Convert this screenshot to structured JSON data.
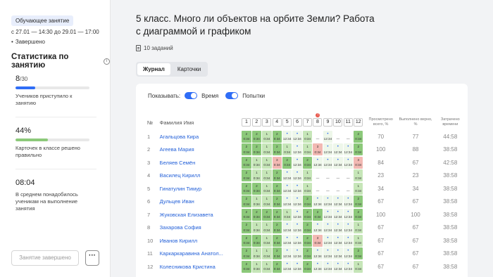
{
  "sidebar": {
    "badge": "Обучающее занятие",
    "dates": "с 27.01 — 14:30   до 29.01 — 17:00",
    "status": "Завершено",
    "stats_title": "Статистика по занятию",
    "stats": [
      {
        "value": "8",
        "suffix": "/30",
        "caption": "Учеников приступило к занятию",
        "progress": 0.27,
        "color": "#2f6df6"
      },
      {
        "value": "44%",
        "suffix": "",
        "caption": "Карточек в классе решено правильно",
        "progress": 0.44,
        "color": "#8cc97a"
      },
      {
        "value": "08:04",
        "suffix": "",
        "caption": "В среднем понадобилось ученикам на выполнение занятия"
      }
    ],
    "finish_button": "Занятие завершено",
    "more_button": "···"
  },
  "main": {
    "title": "5 класс. Много ли объектов  на орбите Земли? Работа с диаграммой и графиком",
    "tasks_count": "10 заданий",
    "tabs": [
      {
        "label": "Журнал",
        "active": true
      },
      {
        "label": "Карточки",
        "active": false
      }
    ],
    "show_label": "Показывать:",
    "toggle_time": "Время",
    "toggle_attempts": "Попытки",
    "headers": {
      "num": "№",
      "name": "Фамилия Имя",
      "viewed": "Просмотрено всего, %",
      "correct": "Выполнено верно, %",
      "spent": "Затрачено времени"
    },
    "task_numbers": [
      "1",
      "2",
      "3",
      "4",
      "5",
      "6",
      "7",
      "8",
      "9",
      "10",
      "11",
      "12"
    ],
    "rows": [
      {
        "n": "1",
        "name": "Агальцова Кира",
        "viewed": "70",
        "correct": "77",
        "time": "44:58",
        "cells": [
          "g2",
          "g2",
          "g1",
          "g2",
          "w0",
          "w0",
          "g1",
          "e0",
          "w0",
          "e0",
          "e0",
          "g2"
        ]
      },
      {
        "n": "2",
        "name": "Агеева Мария",
        "viewed": "100",
        "correct": "88",
        "time": "38:58",
        "cells": [
          "g2",
          "g2",
          "g1",
          "g2",
          "g1",
          "w0",
          "g1",
          "r0",
          "w0",
          "w0",
          "w0",
          "g2"
        ]
      },
      {
        "n": "3",
        "name": "Беляев Семён",
        "viewed": "84",
        "correct": "67",
        "time": "42:58",
        "cells": [
          "g2",
          "g1",
          "g1",
          "r0",
          "g2",
          "w0",
          "g2",
          "w0",
          "w0",
          "w0",
          "w0",
          "r0"
        ]
      },
      {
        "n": "4",
        "name": "Василец Кирилл",
        "viewed": "23",
        "correct": "23",
        "time": "38:58",
        "cells": [
          "g2",
          "g1",
          "g1",
          "g2",
          "w0",
          "w0",
          "g1",
          "e0",
          "e0",
          "e0",
          "e0",
          "g1"
        ]
      },
      {
        "n": "5",
        "name": "Гинатулин Тимур",
        "viewed": "34",
        "correct": "34",
        "time": "38:58",
        "cells": [
          "g2",
          "g2",
          "g1",
          "g2",
          "w0",
          "w0",
          "g1",
          "e0",
          "e0",
          "e0",
          "e0",
          "g1"
        ]
      },
      {
        "n": "6",
        "name": "Дульцев Иван",
        "viewed": "67",
        "correct": "67",
        "time": "38:58",
        "cells": [
          "g2",
          "g1",
          "g1",
          "g2",
          "w0",
          "w0",
          "g2",
          "w0",
          "w0",
          "w0",
          "w0",
          "g2"
        ]
      },
      {
        "n": "7",
        "name": "Жуковская Елизавета",
        "viewed": "100",
        "correct": "100",
        "time": "38:58",
        "cells": [
          "g2",
          "g2",
          "g2",
          "g2",
          "g1",
          "w0",
          "g2",
          "g2",
          "w0",
          "w0",
          "w0",
          "g2"
        ]
      },
      {
        "n": "8",
        "name": "Захарова София",
        "viewed": "67",
        "correct": "67",
        "time": "38:58",
        "cells": [
          "g2",
          "g1",
          "g1",
          "g2",
          "w0",
          "w0",
          "g2",
          "w0",
          "w0",
          "w0",
          "w0",
          "g1"
        ]
      },
      {
        "n": "10",
        "name": "Иванов Кирилл",
        "viewed": "67",
        "correct": "67",
        "time": "38:58",
        "cells": [
          "g2",
          "g2",
          "g1",
          "g2",
          "w0",
          "w0",
          "g2",
          "r0",
          "w0",
          "w0",
          "w0",
          "g1"
        ]
      },
      {
        "n": "11",
        "name": "Каркаркаравина Анатол...",
        "viewed": "67",
        "correct": "67",
        "time": "38:58",
        "cells": [
          "g2",
          "g1",
          "g1",
          "g2",
          "w0",
          "w0",
          "g2",
          "w0",
          "w0",
          "w0",
          "w0",
          "g2"
        ]
      },
      {
        "n": "12",
        "name": "Колесникова Кристина",
        "viewed": "67",
        "correct": "67",
        "time": "38:58",
        "cells": [
          "g2",
          "g1",
          "g1",
          "g2",
          "w0",
          "w0",
          "g2",
          "w0",
          "w0",
          "w0",
          "w0",
          "g1"
        ]
      }
    ],
    "cell_time": "0:34",
    "cell_time_alt": "12:34"
  }
}
